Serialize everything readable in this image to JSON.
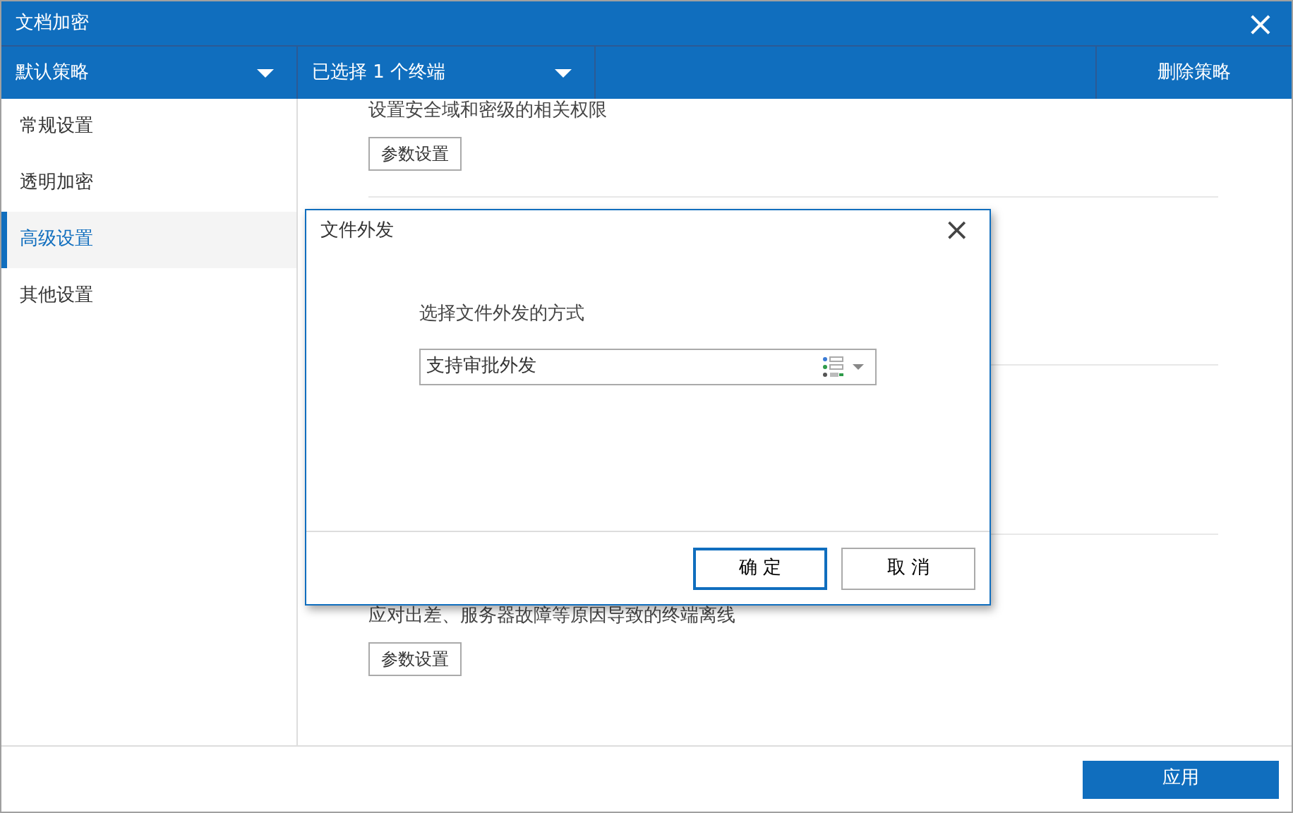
{
  "window": {
    "title": "文档加密",
    "close": "×"
  },
  "toolbar": {
    "policy": "默认策略",
    "terminals": "已选择 1 个终端",
    "delete": "删除策略"
  },
  "sidebar": {
    "items": [
      {
        "label": "常规设置",
        "selected": false
      },
      {
        "label": "透明加密",
        "selected": false
      },
      {
        "label": "高级设置",
        "selected": true
      },
      {
        "label": "其他设置",
        "selected": false
      }
    ]
  },
  "sections": [
    {
      "description": "设置安全域和密级的相关权限",
      "button": "参数设置"
    },
    {
      "description": "应对出差、服务器故障等原因导致的终端离线",
      "button": "参数设置"
    }
  ],
  "dialog": {
    "title": "文件外发",
    "close": "×",
    "label": "选择文件外发的方式",
    "select_value": "支持审批外发",
    "ok": "确 定",
    "cancel": "取 消"
  },
  "footer": {
    "apply": "应用"
  }
}
